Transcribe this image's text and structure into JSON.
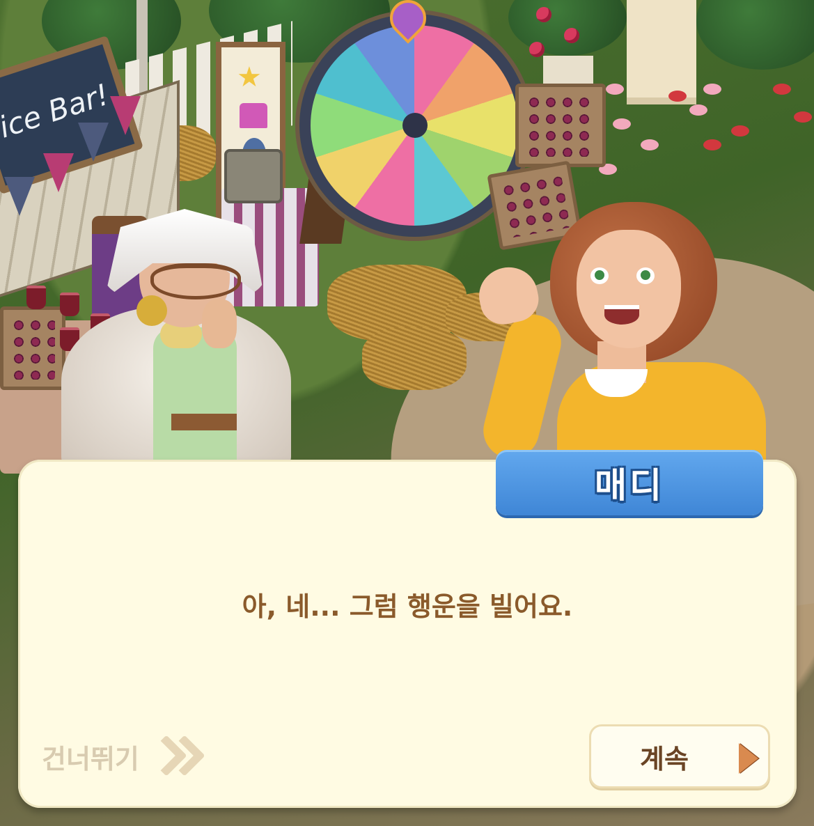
{
  "scene": {
    "stall_sign": "ice Bar!"
  },
  "dialog": {
    "speaker_name": "매디",
    "line": "아, 네... 그럼 행운을 빌어요.",
    "skip_label": "건너뛰기",
    "continue_label": "계속"
  },
  "colors": {
    "dialog_background": "#fffbe3",
    "name_tag": "#4a94e0",
    "dialog_text": "#8a5a2b",
    "skip_text": "#d8cbb0",
    "continue_text": "#6a4424",
    "continue_arrow": "#d98a4f"
  },
  "icons": {
    "skip": "double-chevron-right-icon",
    "continue": "play-arrow-icon"
  }
}
